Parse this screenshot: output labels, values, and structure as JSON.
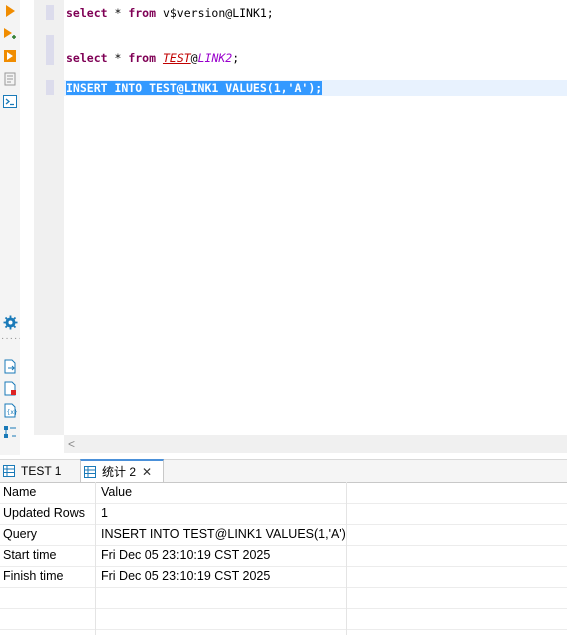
{
  "toolbar": {
    "icons": [
      "run-icon",
      "run-selection-icon",
      "explain-icon",
      "format-icon",
      "terminal-icon",
      "settings-icon",
      "export-icon",
      "pdf-icon",
      "variables-icon",
      "outline-icon"
    ]
  },
  "editor": {
    "lines": [
      {
        "kw": "select",
        "mid": " * ",
        "kw2": "from",
        "rest": " v$version@LINK1;"
      },
      {
        "kw": "select",
        "mid": " * ",
        "kw2": "from",
        "table": "TEST",
        "at": "@",
        "link": "LINK2",
        "end": ";"
      },
      {
        "selected": "INSERT INTO TEST@LINK1 VALUES(1,'A');"
      }
    ]
  },
  "hscroll": {
    "left_arrow": "<"
  },
  "tabs": [
    {
      "label": "TEST 1",
      "active": false
    },
    {
      "label": "统计 2",
      "active": true,
      "close": "✕"
    }
  ],
  "results": {
    "columns": [
      "Name",
      "Value"
    ],
    "rows": [
      [
        "Updated Rows",
        "1"
      ],
      [
        "Query",
        "INSERT INTO TEST@LINK1 VALUES(1,'A')"
      ],
      [
        "Start time",
        "Fri Dec 05 23:10:19 CST 2025"
      ],
      [
        "Finish time",
        "Fri Dec 05 23:10:19 CST 2025"
      ]
    ]
  },
  "colors": {
    "selection": "#3399ff",
    "keyword": "#7f0055",
    "table_ref": "#c00000",
    "link_ref": "#9900cc",
    "active_tab": "#4a90d9"
  }
}
